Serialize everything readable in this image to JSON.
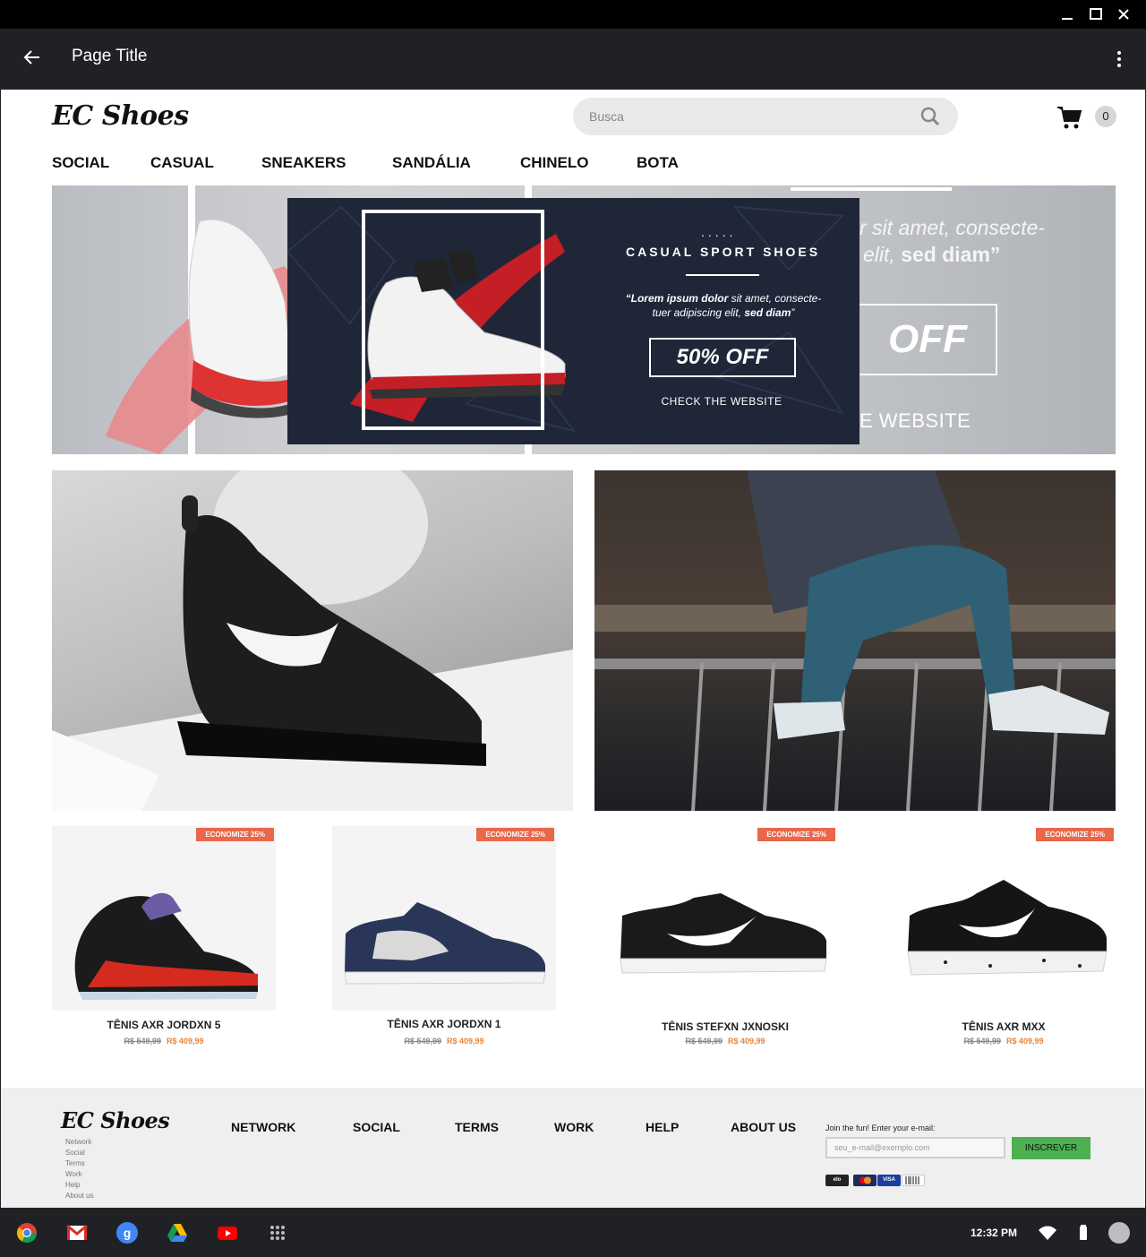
{
  "window": {
    "title": "Page Title"
  },
  "header": {
    "logo": "EC Shoes",
    "search_placeholder": "Busca",
    "cart_count": "0"
  },
  "nav": [
    "SOCIAL",
    "CASUAL",
    "SNEAKERS",
    "SANDÁLIA",
    "CHINELO",
    "BOTA"
  ],
  "hero": {
    "ghost_quote_line1": "r sit amet, consecte-",
    "ghost_quote_line2_a": "elit, ",
    "ghost_quote_line2_b": "sed diam”",
    "ghost_off": "OFF",
    "ghost_website": "E WEBSITE",
    "banner": {
      "dots": ".....",
      "title": "CASUAL SPORT SHOES",
      "quote_bold": "“Lorem ipsum dolor ",
      "quote_italic": "sit amet, consecte-tuer adipiscing elit, ",
      "quote_bold2": "sed diam",
      "quote_end": "”",
      "offer": "50% OFF",
      "cta": "CHECK THE WEBSITE"
    }
  },
  "products": [
    {
      "tag": "ECONOMIZE 25%",
      "name": "TÊNIS AXR JORDXN 5",
      "old_price": "R$ 549,99",
      "new_price": "R$ 409,99"
    },
    {
      "tag": "ECONOMIZE 25%",
      "name": "TÊNIS AXR JORDXN 1",
      "old_price": "R$ 549,99",
      "new_price": "R$ 409,99"
    },
    {
      "tag": "ECONOMIZE 25%",
      "name": "TÊNIS STEFXN JXNOSKI",
      "old_price": "R$ 549,99",
      "new_price": "R$ 409,99"
    },
    {
      "tag": "ECONOMIZE 25%",
      "name": "TÊNIS AXR MXX",
      "old_price": "R$ 549,99",
      "new_price": "R$ 409,99"
    }
  ],
  "footer": {
    "logo": "EC Shoes",
    "small_links": [
      "Network",
      "Social",
      "Terms",
      "Work",
      "Help",
      "About us"
    ],
    "nav": [
      "NETWORK",
      "SOCIAL",
      "TERMS",
      "WORK",
      "HELP",
      "ABOUT US"
    ],
    "join_text": "Join the fun! Enter your e-mail:",
    "email_placeholder": "seu_e-mail@exemplo.com",
    "subscribe_label": "INSCREVER",
    "payments": [
      "elo",
      "mastercard",
      "VISA",
      "boleto"
    ]
  },
  "system": {
    "time": "12:32 PM"
  },
  "colors": {
    "accent_tag": "#e9674a",
    "price": "#e9843a",
    "subscribe": "#4caf50",
    "banner_bg": "#1f2638"
  }
}
